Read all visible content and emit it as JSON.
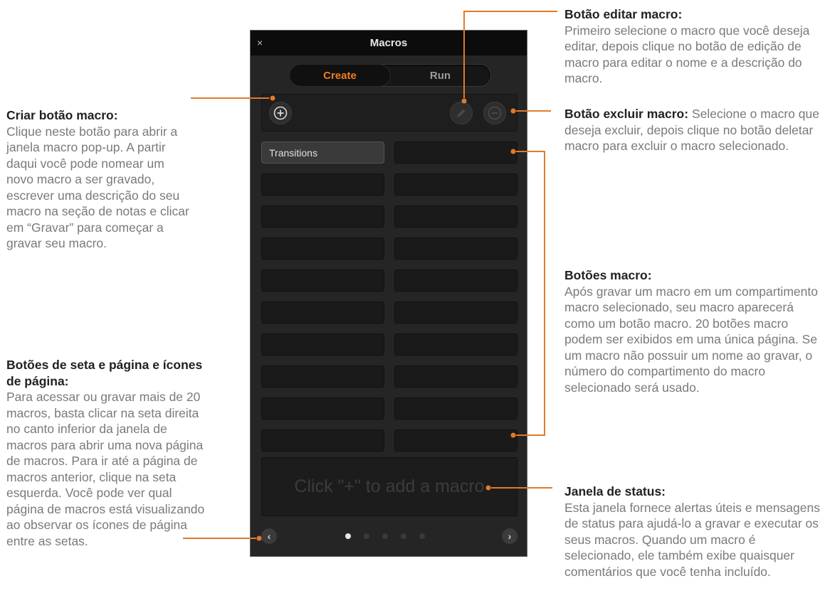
{
  "panel": {
    "close_glyph": "×",
    "title": "Macros",
    "tabs": [
      {
        "label": "Create",
        "active": true
      },
      {
        "label": "Run",
        "active": false
      }
    ],
    "toolbar": {
      "add_icon": "plus-circle-icon",
      "edit_icon": "pencil-icon",
      "delete_icon": "minus-circle-icon"
    },
    "macro_buttons": [
      "Transitions",
      "",
      "",
      "",
      "",
      "",
      "",
      "",
      "",
      "",
      "",
      "",
      "",
      "",
      "",
      "",
      "",
      "",
      "",
      ""
    ],
    "status_text": "Click \"+\" to add a macro",
    "pagination": {
      "pages": 5,
      "current": 1,
      "prev_glyph": "‹",
      "next_glyph": "›"
    },
    "accent_color": "#f07d22"
  },
  "annotations": {
    "criar": {
      "title": "Criar botão macro:",
      "body": "Clique neste botão para abrir a janela macro pop-up. A partir daqui você pode nomear um novo macro a ser gravado, escrever uma descrição do seu macro na seção de notas e clicar em “Gravar” para começar a gravar seu macro."
    },
    "seta": {
      "title": "Botões de seta e página e ícones de página:",
      "body": "Para acessar ou gravar mais de 20 macros, basta clicar na seta direita no canto inferior da janela de macros para abrir uma nova página de macros. Para ir até a página de macros anterior, clique na seta esquerda. Você pode ver qual página de macros está visualizando ao observar os ícones de página entre as setas."
    },
    "editar": {
      "title": "Botão editar macro:",
      "body": "Primeiro selecione o macro que você deseja editar, depois clique no botão de edição de macro para editar o nome e a descrição do macro."
    },
    "excluir": {
      "title": "Botão excluir macro:",
      "body": " Selecione o macro que deseja excluir, depois clique no botão deletar macro para excluir o macro selecionado."
    },
    "botoes": {
      "title": "Botões macro:",
      "body": "Após gravar um macro em um compartimento macro selecionado, seu macro aparecerá como um botão macro. 20 botões macro podem ser exibidos em uma única página. Se um macro não possuir um nome ao gravar, o número do compartimento do macro selecionado será usado."
    },
    "status": {
      "title": "Janela de status:",
      "body": "Esta janela fornece alertas úteis e mensagens de status para ajudá-lo a gravar e executar os seus macros. Quando um macro é selecionado, ele também exibe quaisquer comentários que você tenha incluído."
    }
  },
  "leader_color": "#e07a2c"
}
